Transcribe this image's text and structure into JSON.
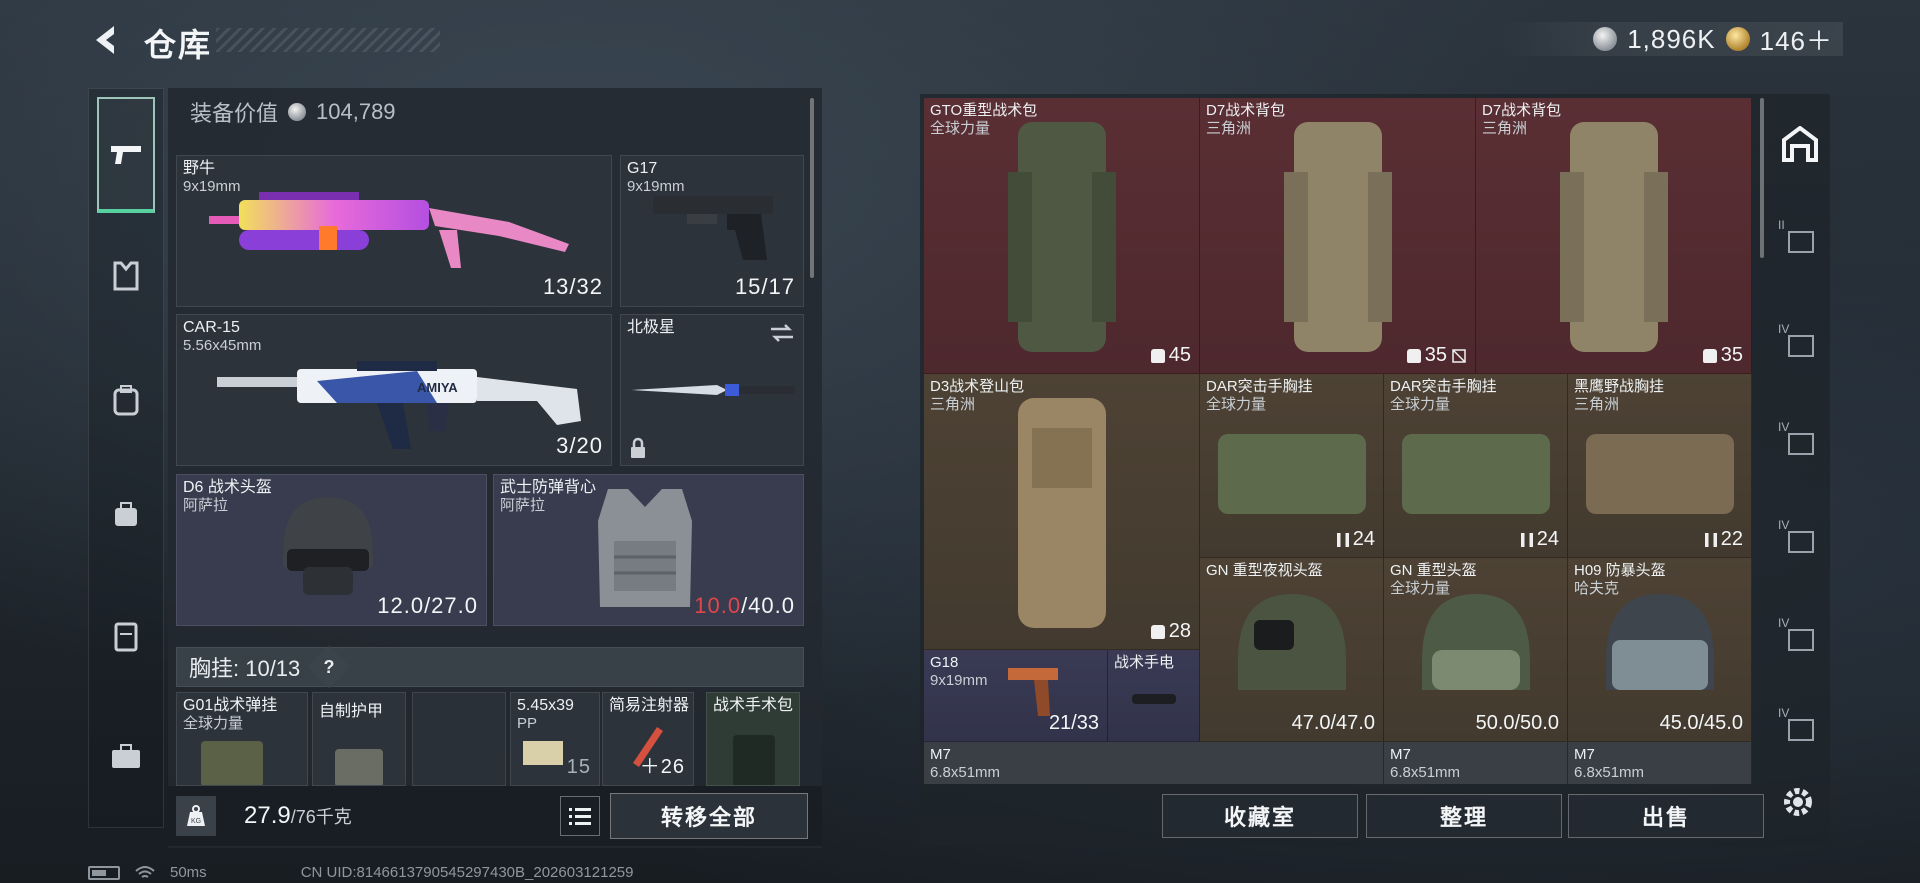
{
  "header": {
    "title": "仓库"
  },
  "currency": {
    "silver": "1,896K",
    "gold": "146＋"
  },
  "loadout": {
    "equip_value_label": "装备价值",
    "equip_value": "104,789",
    "primary1": {
      "name": "野牛",
      "caliber": "9x19mm",
      "ammo": "13/32"
    },
    "pistol": {
      "name": "G17",
      "caliber": "9x19mm",
      "ammo": "15/17"
    },
    "primary2": {
      "name": "CAR-15",
      "caliber": "5.56x45mm",
      "ammo": "3/20",
      "decal": "AMIYA"
    },
    "melee": {
      "name": "北极星"
    },
    "helmet": {
      "name": "D6 战术头盔",
      "faction": "阿萨拉",
      "durability_current": "12.0",
      "durability_max": "/27.0"
    },
    "armor": {
      "name": "武士防弹背心",
      "faction": "阿萨拉",
      "durability_current": "10.0",
      "durability_max": "/40.0"
    },
    "chest_rig_label": "胸挂: 10/13",
    "chest_rig_help": "?",
    "rig_slots": [
      {
        "name": "G01战术弹挂",
        "faction": "全球力量"
      },
      {
        "name": "自制护甲"
      },
      {
        "name": "5.45x39",
        "sub": "PP",
        "count": "15"
      },
      {
        "name": "简易注射器",
        "count": "＋26"
      },
      {
        "name": "战术手术包"
      }
    ],
    "weight": "27.9",
    "weight_max": "/76千克",
    "kg_label": "KG",
    "transfer_all": "转移全部"
  },
  "storage": {
    "items": [
      {
        "name": "GTO重型战术包",
        "faction": "全球力量",
        "capacity": "45"
      },
      {
        "name": "D7战术背包",
        "faction": "三角洲",
        "capacity": "35"
      },
      {
        "name": "D7战术背包",
        "faction": "三角洲",
        "capacity": "35"
      },
      {
        "name": "D3战术登山包",
        "faction": "三角洲",
        "capacity": "28"
      },
      {
        "name": "DAR突击手胸挂",
        "faction": "全球力量",
        "capacity": "24"
      },
      {
        "name": "DAR突击手胸挂",
        "faction": "全球力量",
        "capacity": "24"
      },
      {
        "name": "黑鹰野战胸挂",
        "faction": "三角洲",
        "capacity": "22"
      },
      {
        "name": "GN 重型夜视头盔",
        "durability": "47.0/47.0"
      },
      {
        "name": "GN 重型头盔",
        "faction": "全球力量",
        "durability": "50.0/50.0"
      },
      {
        "name": "H09 防暴头盔",
        "faction": "哈夫克",
        "durability": "45.0/45.0"
      },
      {
        "name": "G18",
        "caliber": "9x19mm",
        "ammo": "21/33"
      },
      {
        "name": "战术手电"
      },
      {
        "name": "M7",
        "caliber": "6.8x51mm"
      },
      {
        "name": "M7",
        "caliber": "6.8x51mm"
      },
      {
        "name": "M7",
        "caliber": "6.8x51mm"
      }
    ],
    "buttons": {
      "vault": "收藏室",
      "sort": "整理",
      "sell": "出售"
    },
    "tab_levels": [
      "II",
      "IV",
      "IV",
      "IV",
      "IV",
      "IV"
    ]
  },
  "status": {
    "ping": "50ms",
    "uid": "CN UID:8146613790545297430B_202603121259"
  },
  "colors": {
    "accent_green": "#57d19f",
    "warning_red": "#e0464a",
    "red_rarity": "#5a2f34",
    "gold_rarity": "#4d4234",
    "purple_rarity": "#3a3a55"
  }
}
